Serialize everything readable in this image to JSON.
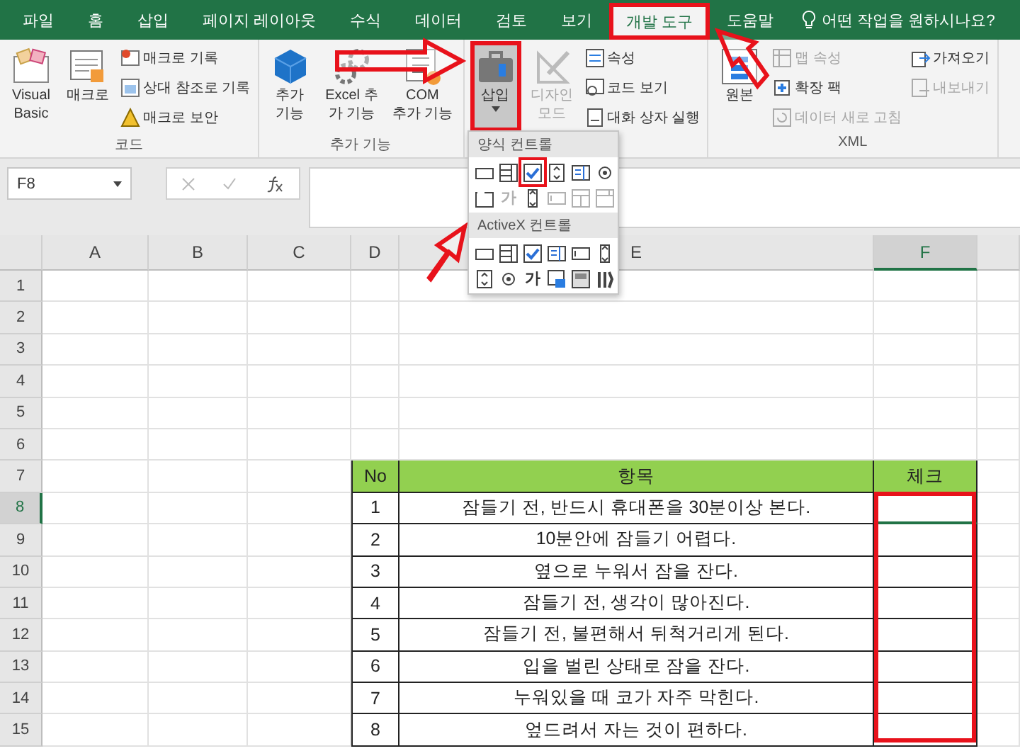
{
  "tabs": [
    {
      "label": "파일",
      "selected": false,
      "highlighted": false
    },
    {
      "label": "홈",
      "selected": false,
      "highlighted": false
    },
    {
      "label": "삽입",
      "selected": false,
      "highlighted": false
    },
    {
      "label": "페이지 레이아웃",
      "selected": false,
      "highlighted": false
    },
    {
      "label": "수식",
      "selected": false,
      "highlighted": false
    },
    {
      "label": "데이터",
      "selected": false,
      "highlighted": false
    },
    {
      "label": "검토",
      "selected": false,
      "highlighted": false
    },
    {
      "label": "보기",
      "selected": false,
      "highlighted": false
    },
    {
      "label": "개발 도구",
      "selected": true,
      "highlighted": true
    },
    {
      "label": "도움말",
      "selected": false,
      "highlighted": false
    }
  ],
  "tell_me": "어떤 작업을 원하시나요?",
  "ribbon": [
    {
      "label": "코드",
      "items": [
        {
          "kind": "large",
          "lines": [
            "Visual",
            "Basic"
          ],
          "disabled": false,
          "highlighted": false
        },
        {
          "kind": "large",
          "lines": [
            "매크로"
          ],
          "disabled": false,
          "highlighted": false
        },
        {
          "kind": "small",
          "lines": [
            "매크로 기록"
          ],
          "disabled": false
        },
        {
          "kind": "small",
          "lines": [
            "상대 참조로 기록"
          ],
          "disabled": false
        },
        {
          "kind": "small",
          "lines": [
            "매크로 보안"
          ],
          "disabled": false
        }
      ]
    },
    {
      "label": "추가 기능",
      "items": [
        {
          "kind": "large",
          "lines": [
            "추가",
            "기능"
          ],
          "disabled": false,
          "highlighted": false
        },
        {
          "kind": "large",
          "lines": [
            "Excel 추",
            "가 기능"
          ],
          "disabled": false,
          "highlighted": false
        },
        {
          "kind": "large",
          "lines": [
            "COM",
            "추가 기능"
          ],
          "disabled": false,
          "highlighted": false
        }
      ]
    },
    {
      "items": [
        {
          "kind": "large",
          "lines": [
            "삽입"
          ],
          "disabled": false,
          "highlighted": true,
          "dropdown": true
        },
        {
          "kind": "large",
          "lines": [
            "디자인",
            "모드"
          ],
          "disabled": true,
          "highlighted": false
        },
        {
          "kind": "small",
          "lines": [
            "속성"
          ],
          "disabled": false
        },
        {
          "kind": "small",
          "lines": [
            "코드 보기"
          ],
          "disabled": false
        },
        {
          "kind": "small",
          "lines": [
            "대화 상자 실행"
          ],
          "disabled": false
        }
      ]
    },
    {
      "label": "XML",
      "items": [
        {
          "kind": "large",
          "lines": [
            "원본"
          ],
          "disabled": false,
          "highlighted": false
        },
        {
          "kind": "small",
          "lines": [
            "맵 속성"
          ],
          "disabled": true
        },
        {
          "kind": "small",
          "lines": [
            "확장 팩"
          ],
          "disabled": false
        },
        {
          "kind": "small",
          "lines": [
            "데이터 새로 고침"
          ],
          "disabled": true
        },
        {
          "kind": "small",
          "lines": [
            "가져오기"
          ],
          "disabled": false
        },
        {
          "kind": "small",
          "lines": [
            "내보내기"
          ],
          "disabled": true
        }
      ]
    }
  ],
  "insert_menu": [
    {
      "title": "양식 컨트롤",
      "items": [
        {
          "kind": "button",
          "disabled": false,
          "highlighted": false
        },
        {
          "kind": "combo",
          "disabled": false,
          "highlighted": false
        },
        {
          "kind": "check",
          "disabled": false,
          "highlighted": true
        },
        {
          "kind": "spin",
          "disabled": false,
          "highlighted": false
        },
        {
          "kind": "list",
          "disabled": false,
          "highlighted": false
        },
        {
          "kind": "option",
          "disabled": false,
          "highlighted": false
        },
        {
          "kind": "group",
          "disabled": false,
          "highlighted": false
        },
        {
          "kind": "label",
          "glyph": "가",
          "disabled": true,
          "highlighted": false
        },
        {
          "kind": "scroll",
          "disabled": false,
          "highlighted": false
        },
        {
          "kind": "text",
          "disabled": true,
          "highlighted": false
        },
        {
          "kind": "listedit",
          "disabled": true,
          "highlighted": false
        },
        {
          "kind": "dropedit",
          "disabled": true,
          "highlighted": false
        }
      ]
    },
    {
      "title": "ActiveX 컨트롤",
      "items": [
        {
          "kind": "button",
          "disabled": false,
          "highlighted": false
        },
        {
          "kind": "combo",
          "disabled": false,
          "highlighted": false
        },
        {
          "kind": "check",
          "disabled": false,
          "highlighted": false
        },
        {
          "kind": "list",
          "disabled": false,
          "highlighted": false
        },
        {
          "kind": "text",
          "disabled": false,
          "highlighted": false
        },
        {
          "kind": "scroll",
          "disabled": false,
          "highlighted": false
        },
        {
          "kind": "spin",
          "disabled": false,
          "highlighted": false
        },
        {
          "kind": "option",
          "disabled": false,
          "highlighted": false
        },
        {
          "kind": "label",
          "glyph": "가",
          "disabled": false,
          "highlighted": false
        },
        {
          "kind": "image",
          "disabled": false,
          "highlighted": false
        },
        {
          "kind": "toggle",
          "disabled": false,
          "highlighted": false
        },
        {
          "kind": "more",
          "disabled": false,
          "highlighted": false
        }
      ]
    }
  ],
  "name_box": "F8",
  "columns": [
    {
      "label": "A",
      "selected": false
    },
    {
      "label": "B",
      "selected": false
    },
    {
      "label": "C",
      "selected": false
    },
    {
      "label": "D",
      "selected": false
    },
    {
      "label": "E",
      "selected": false
    },
    {
      "label": "F",
      "selected": true
    }
  ],
  "rows": [
    {
      "label": "1",
      "selected": false
    },
    {
      "label": "2",
      "selected": false
    },
    {
      "label": "3",
      "selected": false
    },
    {
      "label": "4",
      "selected": false
    },
    {
      "label": "5",
      "selected": false
    },
    {
      "label": "6",
      "selected": false
    },
    {
      "label": "7",
      "selected": false
    },
    {
      "label": "8",
      "selected": true
    },
    {
      "label": "9",
      "selected": false
    },
    {
      "label": "10",
      "selected": false
    },
    {
      "label": "11",
      "selected": false
    },
    {
      "label": "12",
      "selected": false
    },
    {
      "label": "13",
      "selected": false
    },
    {
      "label": "14",
      "selected": false
    },
    {
      "label": "15",
      "selected": false
    }
  ],
  "table": {
    "header": [
      "No",
      "항목",
      "체크"
    ],
    "check_column_highlighted": true,
    "rows": [
      [
        "1",
        "잠들기 전, 반드시 휴대폰을 30분이상 본다.",
        ""
      ],
      [
        "2",
        "10분안에 잠들기 어렵다.",
        ""
      ],
      [
        "3",
        "옆으로 누워서 잠을 잔다.",
        ""
      ],
      [
        "4",
        "잠들기 전, 생각이 많아진다.",
        ""
      ],
      [
        "5",
        "잠들기 전, 불편해서 뒤척거리게 된다.",
        ""
      ],
      [
        "6",
        "입을 벌린 상태로 잠을 잔다.",
        ""
      ],
      [
        "7",
        "누워있을 때 코가 자주 막힌다.",
        ""
      ],
      [
        "8",
        "엎드려서 자는 것이 편하다.",
        ""
      ]
    ]
  }
}
